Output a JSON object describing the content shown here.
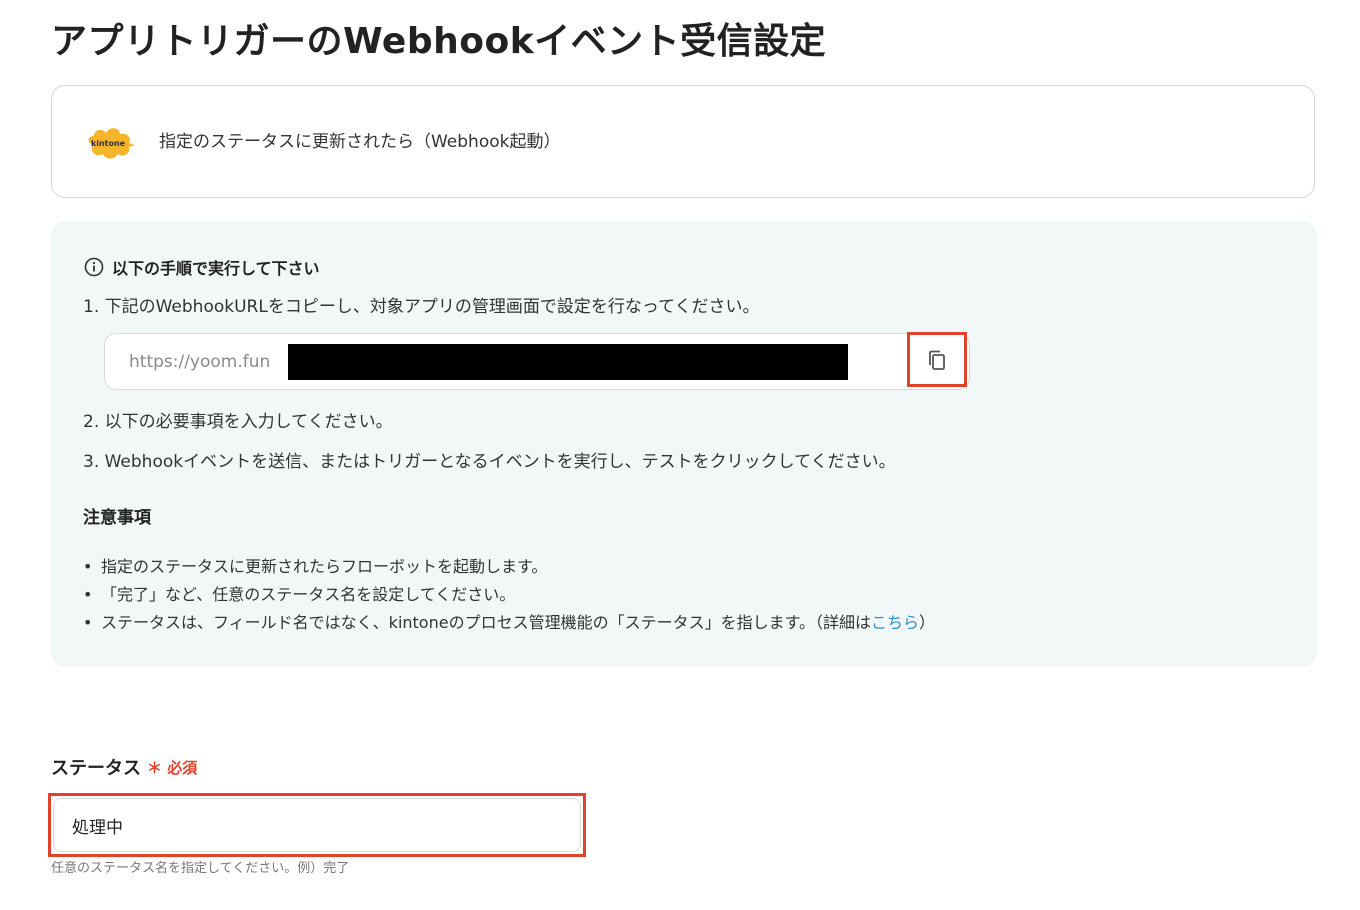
{
  "page": {
    "title": "アプリトリガーのWebhookイベント受信設定"
  },
  "trigger": {
    "app_icon": "kintone-logo",
    "logo_text": "kintone",
    "label": "指定のステータスに更新されたら（Webhook起動）"
  },
  "instructions": {
    "heading": "以下の手順で実行して下さい",
    "step1": "1. 下記のWebhookURLをコピーし、対象アプリの管理画面で設定を行なってください。",
    "webhook_url": "https://yoom.fun",
    "copy_icon": "copy-icon",
    "step2": "2. 以下の必要事項を入力してください。",
    "step3": "3. Webhookイベントを送信、またはトリガーとなるイベントを実行し、テストをクリックしてください。",
    "notes_heading": "注意事項",
    "notes": [
      "指定のステータスに更新されたらフローボットを起動します。",
      "「完了」など、任意のステータス名を設定してください。"
    ],
    "note3_prefix": "ステータスは、フィールド名ではなく、kintoneのプロセス管理機能の「ステータス」を指します。（詳細は",
    "note3_link": "こちら",
    "note3_suffix": "）"
  },
  "status_field": {
    "label": "ステータス",
    "required_mark": "＊ 必須",
    "value": "処理中",
    "hint": "任意のステータス名を指定してください。例）完了"
  },
  "colors": {
    "highlight": "#e0432c",
    "info_bg": "#f2f8f8",
    "link": "#2e8fcf",
    "kintone_yellow": "#f7b52c"
  }
}
